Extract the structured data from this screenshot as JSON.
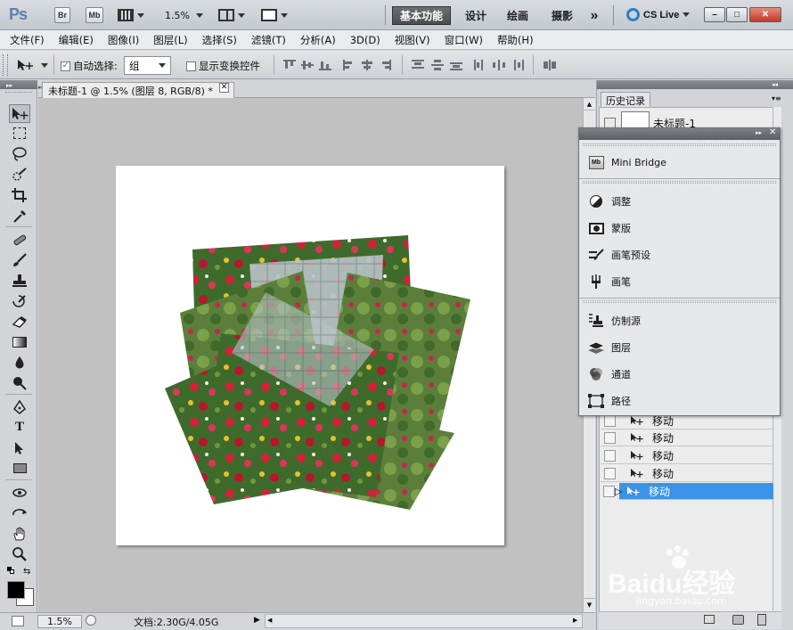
{
  "app": {
    "logo": "Ps",
    "bridge_btn": "Br",
    "minibridge_btn": "Mb",
    "zoom": "1.5%",
    "workspaces": [
      "基本功能",
      "设计",
      "绘画",
      "摄影"
    ],
    "more": "»",
    "cslive": "CS Live",
    "win_controls": [
      "–",
      "□",
      "✕"
    ]
  },
  "menu": [
    "文件(F)",
    "编辑(E)",
    "图像(I)",
    "图层(L)",
    "选择(S)",
    "滤镜(T)",
    "分析(A)",
    "3D(D)",
    "视图(V)",
    "窗口(W)",
    "帮助(H)"
  ],
  "options": {
    "auto_select_label": "自动选择:",
    "auto_select_checked": true,
    "auto_select_value": "组",
    "show_transform_label": "显示变换控件",
    "show_transform_checked": false
  },
  "document": {
    "tab_title": "未标题-1 @ 1.5% (图层 8, RGB/8) *",
    "close": "✕"
  },
  "status": {
    "zoom": "1.5%",
    "doc_info": "文档:2.30G/4.05G"
  },
  "history": {
    "tab": "历史记录",
    "snapshot": "未标题-1",
    "rows": [
      {
        "label": "移动",
        "active": false
      },
      {
        "label": "移动",
        "active": false
      },
      {
        "label": "移动",
        "active": false
      },
      {
        "label": "移动",
        "active": false
      },
      {
        "label": "移动",
        "active": true
      }
    ]
  },
  "floating_panel": {
    "items": [
      {
        "label": "Mini Bridge",
        "icon": "mini-bridge-icon"
      },
      {
        "label": "调整",
        "icon": "adjustments-icon"
      },
      {
        "label": "蒙版",
        "icon": "masks-icon"
      },
      {
        "label": "画笔预设",
        "icon": "brush-presets-icon"
      },
      {
        "label": "画笔",
        "icon": "brush-icon"
      },
      {
        "label": "仿制源",
        "icon": "clone-source-icon"
      },
      {
        "label": "图层",
        "icon": "layers-icon"
      },
      {
        "label": "通道",
        "icon": "channels-icon"
      },
      {
        "label": "路径",
        "icon": "paths-icon"
      }
    ]
  },
  "watermark": {
    "brand": "Baidu经验",
    "url": "jingyan.baidu.com"
  },
  "colors": {
    "accent_active": "#3b93e8",
    "canvas": "#ffffff",
    "workspace_bg": "#c1c1c1"
  }
}
